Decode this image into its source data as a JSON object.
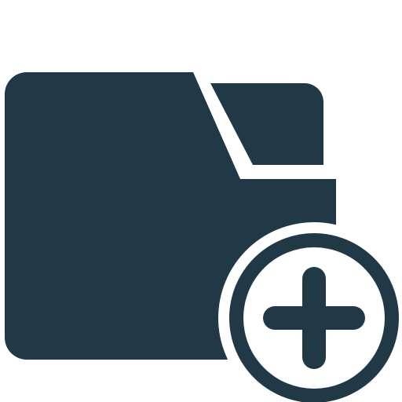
{
  "icon": {
    "semantic_name": "add-folder-icon",
    "colors": {
      "primary": "#213847",
      "background": "#ffffff"
    }
  }
}
